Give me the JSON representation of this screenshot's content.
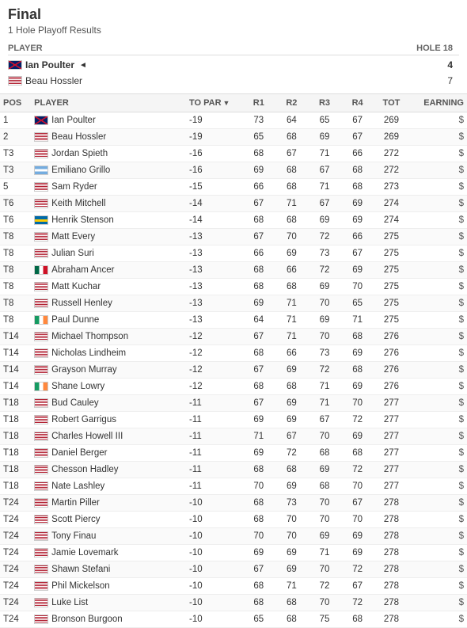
{
  "page": {
    "title": "Final",
    "playoff_label": "1 Hole Playoff Results",
    "playoff_header": {
      "player": "PLAYER",
      "hole": "HOLE 18"
    },
    "playoff_players": [
      {
        "name": "Ian Poulter",
        "flag": "gb",
        "score": "4",
        "winner": true
      },
      {
        "name": "Beau Hossler",
        "flag": "usa",
        "score": "7",
        "winner": false
      }
    ],
    "table_headers": {
      "pos": "POS",
      "player": "PLAYER",
      "topar": "TO PAR",
      "r1": "R1",
      "r2": "R2",
      "r3": "R3",
      "r4": "R4",
      "tot": "TOT",
      "earnings": "EARNING"
    },
    "rows": [
      {
        "pos": "1",
        "name": "Ian Poulter",
        "flag": "gb",
        "topar": "-19",
        "r1": "73",
        "r2": "64",
        "r3": "65",
        "r4": "67",
        "tot": "269",
        "earn": "$"
      },
      {
        "pos": "2",
        "name": "Beau Hossler",
        "flag": "usa",
        "topar": "-19",
        "r1": "65",
        "r2": "68",
        "r3": "69",
        "r4": "67",
        "tot": "269",
        "earn": "$"
      },
      {
        "pos": "T3",
        "name": "Jordan Spieth",
        "flag": "usa",
        "topar": "-16",
        "r1": "68",
        "r2": "67",
        "r3": "71",
        "r4": "66",
        "tot": "272",
        "earn": "$"
      },
      {
        "pos": "T3",
        "name": "Emiliano Grillo",
        "flag": "arg",
        "topar": "-16",
        "r1": "69",
        "r2": "68",
        "r3": "67",
        "r4": "68",
        "tot": "272",
        "earn": "$"
      },
      {
        "pos": "5",
        "name": "Sam Ryder",
        "flag": "usa",
        "topar": "-15",
        "r1": "66",
        "r2": "68",
        "r3": "71",
        "r4": "68",
        "tot": "273",
        "earn": "$"
      },
      {
        "pos": "T6",
        "name": "Keith Mitchell",
        "flag": "usa",
        "topar": "-14",
        "r1": "67",
        "r2": "71",
        "r3": "67",
        "r4": "69",
        "tot": "274",
        "earn": "$"
      },
      {
        "pos": "T6",
        "name": "Henrik Stenson",
        "flag": "swe",
        "topar": "-14",
        "r1": "68",
        "r2": "68",
        "r3": "69",
        "r4": "69",
        "tot": "274",
        "earn": "$"
      },
      {
        "pos": "T8",
        "name": "Matt Every",
        "flag": "usa",
        "topar": "-13",
        "r1": "67",
        "r2": "70",
        "r3": "72",
        "r4": "66",
        "tot": "275",
        "earn": "$"
      },
      {
        "pos": "T8",
        "name": "Julian Suri",
        "flag": "usa",
        "topar": "-13",
        "r1": "66",
        "r2": "69",
        "r3": "73",
        "r4": "67",
        "tot": "275",
        "earn": "$"
      },
      {
        "pos": "T8",
        "name": "Abraham Ancer",
        "flag": "mex",
        "topar": "-13",
        "r1": "68",
        "r2": "66",
        "r3": "72",
        "r4": "69",
        "tot": "275",
        "earn": "$"
      },
      {
        "pos": "T8",
        "name": "Matt Kuchar",
        "flag": "usa",
        "topar": "-13",
        "r1": "68",
        "r2": "68",
        "r3": "69",
        "r4": "70",
        "tot": "275",
        "earn": "$"
      },
      {
        "pos": "T8",
        "name": "Russell Henley",
        "flag": "usa",
        "topar": "-13",
        "r1": "69",
        "r2": "71",
        "r3": "70",
        "r4": "65",
        "tot": "275",
        "earn": "$"
      },
      {
        "pos": "T8",
        "name": "Paul Dunne",
        "flag": "ire",
        "topar": "-13",
        "r1": "64",
        "r2": "71",
        "r3": "69",
        "r4": "71",
        "tot": "275",
        "earn": "$"
      },
      {
        "pos": "T14",
        "name": "Michael Thompson",
        "flag": "usa",
        "topar": "-12",
        "r1": "67",
        "r2": "71",
        "r3": "70",
        "r4": "68",
        "tot": "276",
        "earn": "$"
      },
      {
        "pos": "T14",
        "name": "Nicholas Lindheim",
        "flag": "usa",
        "topar": "-12",
        "r1": "68",
        "r2": "66",
        "r3": "73",
        "r4": "69",
        "tot": "276",
        "earn": "$"
      },
      {
        "pos": "T14",
        "name": "Grayson Murray",
        "flag": "usa",
        "topar": "-12",
        "r1": "67",
        "r2": "69",
        "r3": "72",
        "r4": "68",
        "tot": "276",
        "earn": "$"
      },
      {
        "pos": "T14",
        "name": "Shane Lowry",
        "flag": "ire",
        "topar": "-12",
        "r1": "68",
        "r2": "68",
        "r3": "71",
        "r4": "69",
        "tot": "276",
        "earn": "$"
      },
      {
        "pos": "T18",
        "name": "Bud Cauley",
        "flag": "usa",
        "topar": "-11",
        "r1": "67",
        "r2": "69",
        "r3": "71",
        "r4": "70",
        "tot": "277",
        "earn": "$"
      },
      {
        "pos": "T18",
        "name": "Robert Garrigus",
        "flag": "usa",
        "topar": "-11",
        "r1": "69",
        "r2": "69",
        "r3": "67",
        "r4": "72",
        "tot": "277",
        "earn": "$"
      },
      {
        "pos": "T18",
        "name": "Charles Howell III",
        "flag": "usa",
        "topar": "-11",
        "r1": "71",
        "r2": "67",
        "r3": "70",
        "r4": "69",
        "tot": "277",
        "earn": "$"
      },
      {
        "pos": "T18",
        "name": "Daniel Berger",
        "flag": "usa",
        "topar": "-11",
        "r1": "69",
        "r2": "72",
        "r3": "68",
        "r4": "68",
        "tot": "277",
        "earn": "$"
      },
      {
        "pos": "T18",
        "name": "Chesson Hadley",
        "flag": "usa",
        "topar": "-11",
        "r1": "68",
        "r2": "68",
        "r3": "69",
        "r4": "72",
        "tot": "277",
        "earn": "$"
      },
      {
        "pos": "T18",
        "name": "Nate Lashley",
        "flag": "usa",
        "topar": "-11",
        "r1": "70",
        "r2": "69",
        "r3": "68",
        "r4": "70",
        "tot": "277",
        "earn": "$"
      },
      {
        "pos": "T24",
        "name": "Martin Piller",
        "flag": "usa",
        "topar": "-10",
        "r1": "68",
        "r2": "73",
        "r3": "70",
        "r4": "67",
        "tot": "278",
        "earn": "$"
      },
      {
        "pos": "T24",
        "name": "Scott Piercy",
        "flag": "usa",
        "topar": "-10",
        "r1": "68",
        "r2": "70",
        "r3": "70",
        "r4": "70",
        "tot": "278",
        "earn": "$"
      },
      {
        "pos": "T24",
        "name": "Tony Finau",
        "flag": "usa",
        "topar": "-10",
        "r1": "70",
        "r2": "70",
        "r3": "69",
        "r4": "69",
        "tot": "278",
        "earn": "$"
      },
      {
        "pos": "T24",
        "name": "Jamie Lovemark",
        "flag": "usa",
        "topar": "-10",
        "r1": "69",
        "r2": "69",
        "r3": "71",
        "r4": "69",
        "tot": "278",
        "earn": "$"
      },
      {
        "pos": "T24",
        "name": "Shawn Stefani",
        "flag": "usa",
        "topar": "-10",
        "r1": "67",
        "r2": "69",
        "r3": "70",
        "r4": "72",
        "tot": "278",
        "earn": "$"
      },
      {
        "pos": "T24",
        "name": "Phil Mickelson",
        "flag": "usa",
        "topar": "-10",
        "r1": "68",
        "r2": "71",
        "r3": "72",
        "r4": "67",
        "tot": "278",
        "earn": "$"
      },
      {
        "pos": "T24",
        "name": "Luke List",
        "flag": "usa",
        "topar": "-10",
        "r1": "68",
        "r2": "68",
        "r3": "70",
        "r4": "72",
        "tot": "278",
        "earn": "$"
      },
      {
        "pos": "T24",
        "name": "Bronson Burgoon",
        "flag": "usa",
        "topar": "-10",
        "r1": "65",
        "r2": "68",
        "r3": "75",
        "r4": "68",
        "tot": "278",
        "earn": "$"
      }
    ]
  }
}
